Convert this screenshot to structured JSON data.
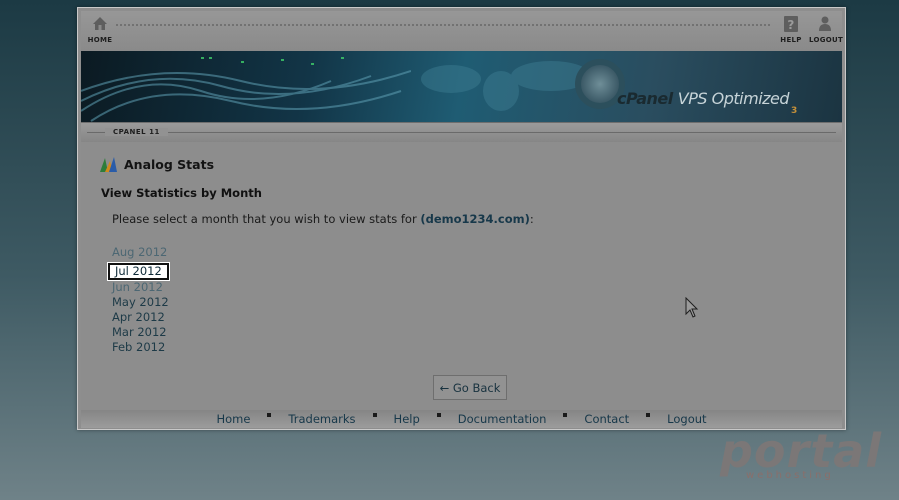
{
  "toolbar": {
    "home_label": "HOME",
    "help_label": "HELP",
    "logout_label": "LOGOUT"
  },
  "banner": {
    "brand_cpanel": "cPanel",
    "brand_product": "VPS Optimized",
    "brand_version": "3"
  },
  "version_tag": "CPANEL 11",
  "page": {
    "title": "Analog Stats",
    "subtitle": "View Statistics by Month",
    "prompt_text": "Please select a month that you wish to view stats for",
    "domain": "(demo1234.com)",
    "prompt_suffix": ":"
  },
  "months": [
    {
      "label": "Aug 2012",
      "state": "faded"
    },
    {
      "label": "Jul 2012",
      "state": "selected"
    },
    {
      "label": "Jun 2012",
      "state": "faded"
    },
    {
      "label": "May 2012",
      "state": "normal"
    },
    {
      "label": "Apr 2012",
      "state": "normal"
    },
    {
      "label": "Mar 2012",
      "state": "normal"
    },
    {
      "label": "Feb 2012",
      "state": "normal"
    }
  ],
  "go_back_label": "← Go Back",
  "footer": {
    "links": [
      "Home",
      "Trademarks",
      "Help",
      "Documentation",
      "Contact",
      "Logout"
    ]
  },
  "watermark": {
    "big": "portal",
    "small": "webhosting"
  },
  "colors": {
    "link": "#17384a",
    "panel": "#8d8d8d",
    "accent": "#c4903a"
  }
}
